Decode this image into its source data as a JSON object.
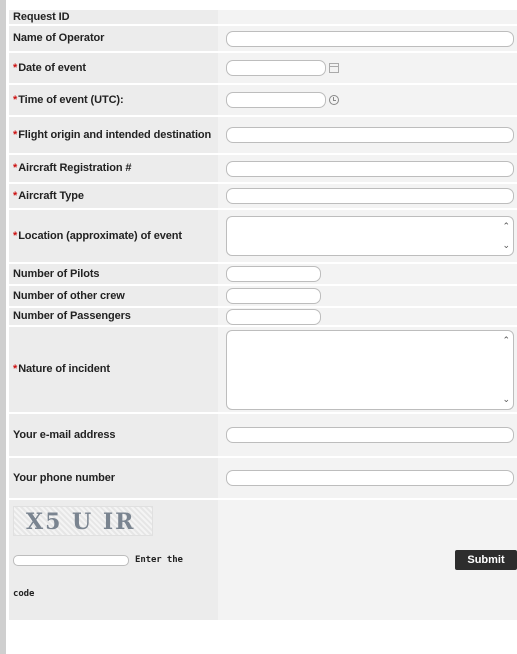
{
  "fields": {
    "request_id": {
      "label": "Request ID"
    },
    "operator": {
      "label": "Name of Operator",
      "value": ""
    },
    "date": {
      "label": "Date of event",
      "required": "*",
      "value": "",
      "icon": "calendar-icon"
    },
    "time": {
      "label": "Time of event (UTC):",
      "required": "*",
      "value": "",
      "icon": "clock-icon"
    },
    "flight": {
      "label": "Flight origin and intended destination",
      "required": "*",
      "value": ""
    },
    "registration": {
      "label": "Aircraft Registration #",
      "required": "*",
      "value": ""
    },
    "aircraft_type": {
      "label": "Aircraft Type",
      "required": "*",
      "value": ""
    },
    "location": {
      "label": "Location (approximate) of event",
      "required": "*",
      "value": ""
    },
    "pilots": {
      "label": "Number of Pilots",
      "value": ""
    },
    "crew": {
      "label": "Number of other crew",
      "value": ""
    },
    "passengers": {
      "label": "Number of Passengers",
      "value": ""
    },
    "nature": {
      "label": "Nature of incident",
      "required": "*",
      "value": ""
    },
    "email": {
      "label": "Your e-mail address",
      "value": ""
    },
    "phone": {
      "label": "Your phone number",
      "value": ""
    }
  },
  "captcha": {
    "image_text": "X5 U IR",
    "prompt_part1": "Enter the",
    "prompt_part2": "code",
    "value": ""
  },
  "submit_label": "Submit",
  "colors": {
    "label_bg": "#ececec",
    "field_bg": "#f3f3f3",
    "required": "#cc1111",
    "submit_bg": "#2d2d2d"
  }
}
